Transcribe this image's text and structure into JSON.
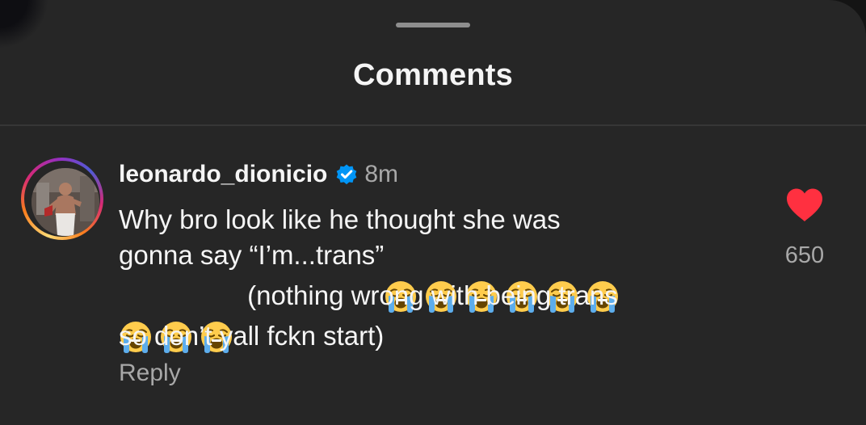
{
  "sheet": {
    "title": "Comments"
  },
  "comment": {
    "username": "leonardo_dionicio",
    "verified_icon": "verified-badge-icon",
    "timestamp": "8m",
    "text_parts": {
      "line1": "Why bro look like he thought she was",
      "line2": "gonna say “I’m...trans”",
      "line3": "(nothing wrong with being trans",
      "line4": "so don’t yall fckn start)"
    },
    "emoji_name": "loudly-crying-face-icon",
    "reply_label": "Reply",
    "like_count": "650",
    "liked": true
  },
  "colors": {
    "background": "#262626",
    "text": "#f5f5f5",
    "secondary_text": "#a8a8a8",
    "verified_blue": "#0095f6",
    "like_red": "#ff3040"
  }
}
